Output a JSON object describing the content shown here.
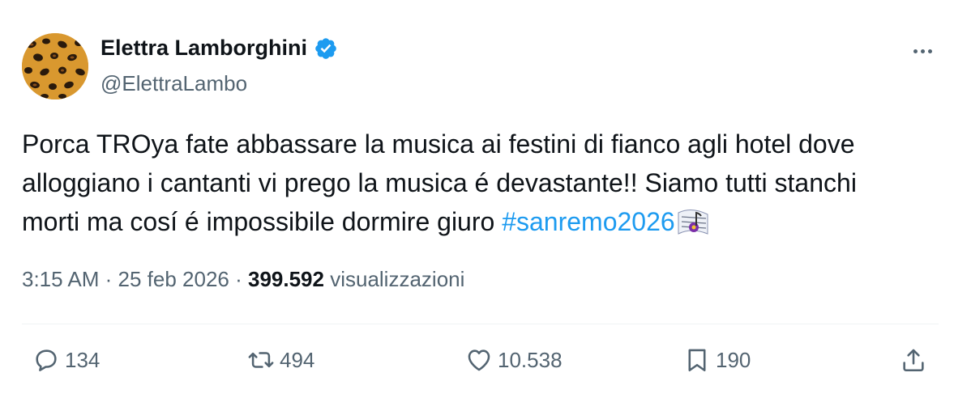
{
  "author": {
    "display_name": "Elettra Lamborghini",
    "handle": "@ElettraLambo",
    "verified": true,
    "verified_color": "#1d9bf0",
    "avatar": "leopard-print-avatar"
  },
  "tweet": {
    "text_lines": [
      "Porca TROya fate abbassare la musica ai festini di fianco agli hotel dove",
      "alloggiano i cantanti vi prego la musica é devastante!! Siamo tutti stanchi",
      "morti ma cosí é impossibile dormire giuro "
    ],
    "hashtag": "#sanremo2026",
    "hashtag_emoji": "sanremo-emoji",
    "time": "3:15 AM",
    "separator": " · ",
    "date": "25 feb 2026",
    "views_count": "399.592",
    "views_label": "visualizzazioni"
  },
  "actions": {
    "reply_count": "134",
    "retweet_count": "494",
    "like_count": "10.538",
    "bookmark_count": "190"
  },
  "colors": {
    "text": "#0f1419",
    "secondary": "#536471",
    "link": "#1d9bf0",
    "divider": "#eff3f4"
  }
}
